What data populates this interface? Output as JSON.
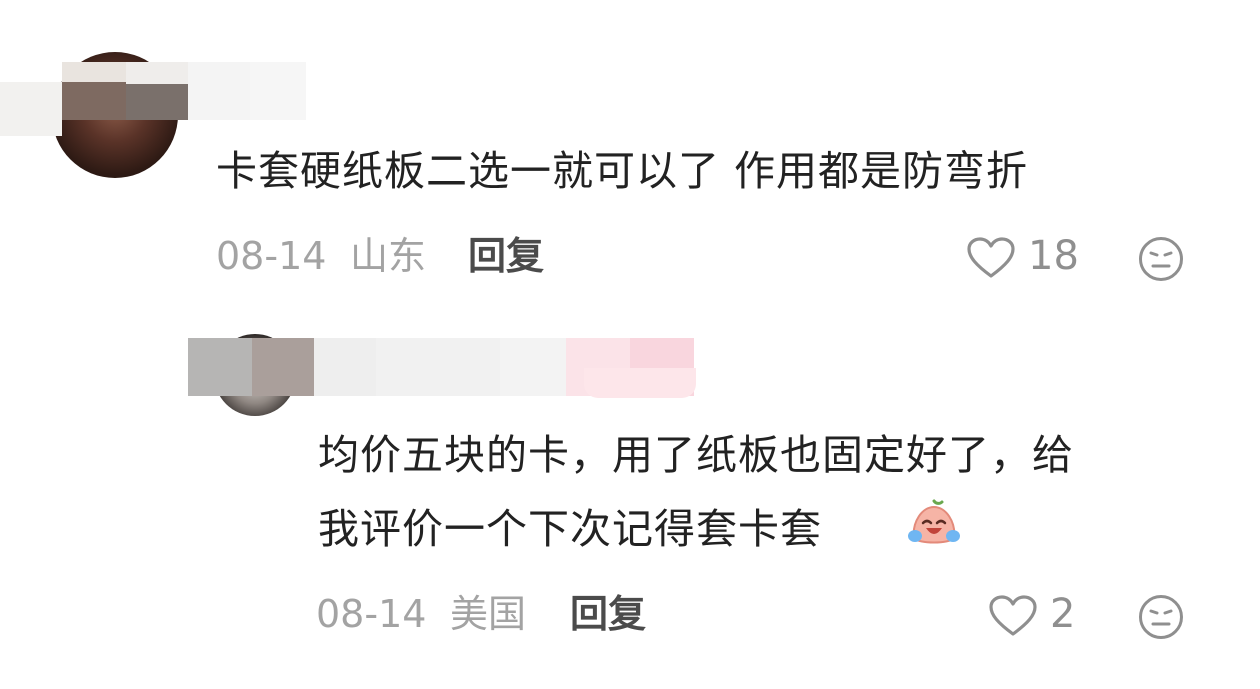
{
  "comments": [
    {
      "text": "卡套硬纸板二选一就可以了 作用都是防弯折",
      "date": "08-14",
      "location": "山东",
      "reply_label": "回复",
      "likes": "18",
      "icons": [
        "heart-outline-icon",
        "neutral-face-icon"
      ]
    },
    {
      "text_line1": "均价五块的卡，用了纸板也固定好了，给",
      "text_line2": "我评价一个下次记得套卡套",
      "emoji": "crying-laughing-emoji",
      "date": "08-14",
      "location": "美国",
      "reply_label": "回复",
      "likes": "2",
      "icons": [
        "heart-outline-icon",
        "neutral-face-icon"
      ]
    }
  ],
  "colors": {
    "text": "#222222",
    "meta": "#a3a3a3",
    "reply": "#4b4b4b",
    "icon": "#8f8f8f",
    "badge_pink": "#fbe0e6"
  }
}
